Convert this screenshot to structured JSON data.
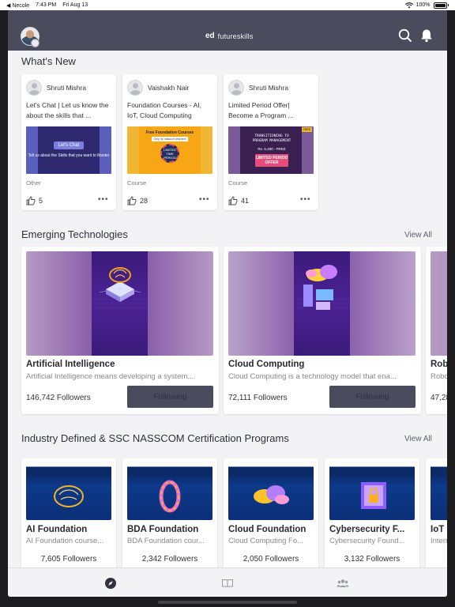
{
  "status_bar": {
    "back_app": "◀ Necole",
    "time": "7:43 PM",
    "date": "Fri Aug 13",
    "battery": "100%"
  },
  "header": {
    "logo_ed": "ed",
    "logo_text": "futureskills"
  },
  "whats_new": {
    "title": "What's New",
    "cards": [
      {
        "author": "Shruti Mishra",
        "text": "Let's Chat | Let us know the about the skills that ...",
        "thumb_pill": "Let's Chat",
        "thumb_sub": "Tell us about the Skills that you want to Master",
        "type": "Other",
        "likes": "5"
      },
      {
        "author": "Vaishakh Nair",
        "text": "Foundation Courses - AI, IoT, Cloud Computing",
        "thumb_title": "Free Foundation Courses",
        "thumb_band": "Only for nasscom learners",
        "thumb_circle": "LIMITED TIME PERIOD",
        "type": "Course",
        "likes": "28"
      },
      {
        "author": "Shruti Mishra",
        "text": "Limited Period Offer| Become a Program ...",
        "thumb_title": "TRANSITIONING TO PROGRAM MANAGEMENT",
        "thumb_price": "Rs. 6,490 - FREE",
        "thumb_label": "LIMITED PERIOD OFFER",
        "thumb_badge": "FREE",
        "type": "Course",
        "likes": "41"
      }
    ]
  },
  "emerging": {
    "title": "Emerging Technologies",
    "view_all": "View All",
    "cards": [
      {
        "title": "Artificial Intelligence",
        "desc": "Artificial Intelligence means developing a system...",
        "followers": "146,742 Followers",
        "button": "Following"
      },
      {
        "title": "Cloud Computing",
        "desc": "Cloud Computing is a technology model that ena...",
        "followers": "72,111 Followers",
        "button": "Following"
      },
      {
        "title": "Rob",
        "desc": "Robo",
        "followers": "47,28"
      }
    ]
  },
  "industry": {
    "title": "Industry Defined & SSC NASSCOM Certification Programs",
    "view_all": "View All",
    "cards": [
      {
        "title": "AI Foundation",
        "desc": "AI Foundation course...",
        "followers": "7,605 Followers"
      },
      {
        "title": "BDA Foundation",
        "desc": "BDA Foundation cour...",
        "followers": "2,342 Followers"
      },
      {
        "title": "Cloud Foundation",
        "desc": "Cloud Computing Fo...",
        "followers": "2,050 Followers"
      },
      {
        "title": "Cybersecurity F...",
        "desc": "Cybersecurity Found...",
        "followers": "3,132 Followers"
      },
      {
        "title": "IoT",
        "desc": "Intern"
      }
    ]
  },
  "icons": {
    "search": "search-icon",
    "bell": "bell-icon",
    "like": "thumbs-up-icon",
    "more": "more-horizontal-icon",
    "explore": "compass-icon",
    "book": "book-icon",
    "community": "people-icon"
  },
  "colors": {
    "header_bg": "#4a4c5d",
    "page_bg": "#f3f3f6",
    "button_bg": "#4a4c5d"
  }
}
